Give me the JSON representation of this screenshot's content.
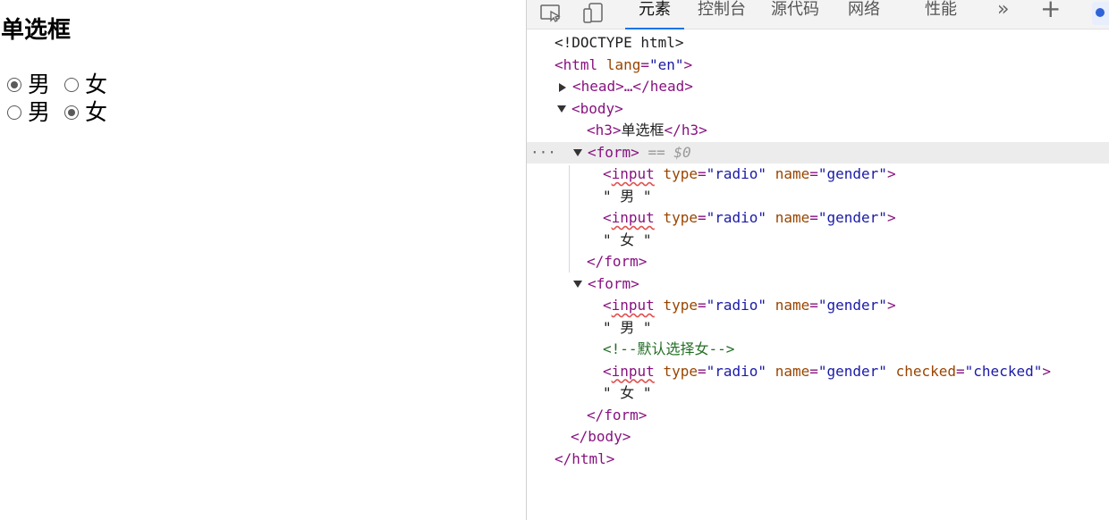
{
  "page": {
    "title": "单选框",
    "rows": [
      {
        "options": [
          {
            "label": "男",
            "checked": true
          },
          {
            "label": "女",
            "checked": false
          }
        ]
      },
      {
        "options": [
          {
            "label": "男",
            "checked": false
          },
          {
            "label": "女",
            "checked": true
          }
        ]
      }
    ]
  },
  "devtools": {
    "tabs": [
      "元素",
      "控制台",
      "源代码",
      "网络",
      "性能"
    ],
    "active_tab": "元素",
    "more_tabs": "»",
    "add_tab": "+",
    "code": {
      "doctype": "<!DOCTYPE html>",
      "html_open_tag": "<html",
      "lang_attr": "lang",
      "lang_val": "\"en\"",
      "html_open_close": ">",
      "head_collapsed": "<head>…</head>",
      "body_open": "<body>",
      "h3_open": "<h3>",
      "h3_text": "单选框",
      "h3_close": "</h3>",
      "form_open": "<form>",
      "selected_marker": "== $0",
      "input_lt": "<",
      "input_name": "input",
      "type_attr": "type",
      "type_val": "\"radio\"",
      "name_attr": "name",
      "name_val": "\"gender\"",
      "checked_attr": "checked",
      "checked_val": "\"checked\"",
      "gt": ">",
      "text_male": "\" 男 \"",
      "text_female": "\" 女 \"",
      "comment": "<!--默认选择女-->",
      "form_close": "</form>",
      "body_close": "</body>",
      "html_close": "</html>",
      "dots": "···"
    }
  }
}
